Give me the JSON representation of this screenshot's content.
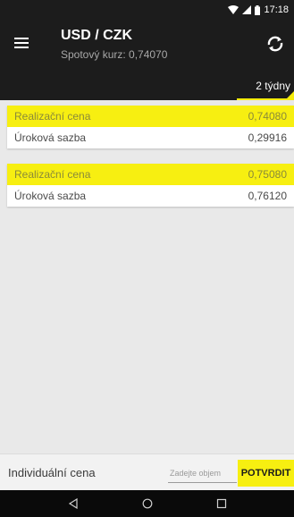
{
  "status_bar": {
    "time": "17:18",
    "icons": [
      "wifi-icon",
      "cell-signal-icon",
      "battery-icon"
    ]
  },
  "header": {
    "title": "USD / CZK",
    "subtitle": "Spotový kurz: 0,74070",
    "left_icon": "menu-icon",
    "right_icon": "refresh-icon"
  },
  "tabs": {
    "selected": "2 týdny"
  },
  "cards": [
    {
      "rows": [
        {
          "label": "Realizační cena",
          "value": "0,74080"
        },
        {
          "label": "Úroková sazba",
          "value": "0,29916"
        }
      ]
    },
    {
      "rows": [
        {
          "label": "Realizační cena",
          "value": "0,75080"
        },
        {
          "label": "Úroková sazba",
          "value": "0,76120"
        }
      ]
    }
  ],
  "bottom_bar": {
    "label": "Individuální cena",
    "input_placeholder": "Zadejte objem",
    "input_value": "",
    "confirm_label": "POTVRDIT"
  },
  "colors": {
    "accent": "#f7ef11",
    "header_bg": "#1c1c1c",
    "page_bg": "#e9e9e9"
  },
  "nav_bar": {
    "buttons": [
      "back-icon",
      "home-icon",
      "recents-icon"
    ]
  }
}
